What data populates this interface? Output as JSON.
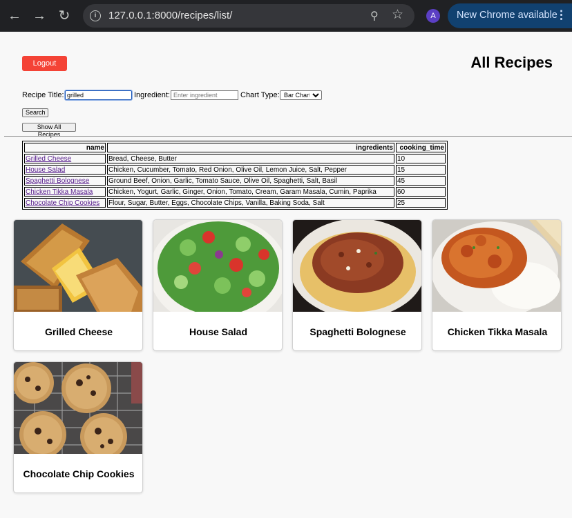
{
  "browser": {
    "url": "127.0.0.1:8000/recipes/list/",
    "avatar_letter": "A",
    "update_label": "New Chrome available"
  },
  "header": {
    "logout_label": "Logout",
    "title": "All Recipes"
  },
  "search": {
    "title_label": "Recipe Title:",
    "title_value": "grilled",
    "ingredient_label": "Ingredient:",
    "ingredient_placeholder": "Enter ingredient",
    "chart_label": "Chart Type:",
    "chart_value": "Bar Chart",
    "search_label": "Search",
    "show_all_label": "Show All Recipes"
  },
  "table": {
    "headers": [
      "name",
      "ingredients",
      "cooking_time"
    ],
    "rows": [
      {
        "name": "Grilled Cheese",
        "ingredients": "Bread, Cheese, Butter",
        "cooking_time": "10"
      },
      {
        "name": "House Salad",
        "ingredients": "Chicken, Cucumber, Tomato, Red Onion, Olive Oil, Lemon Juice, Salt, Pepper",
        "cooking_time": "15"
      },
      {
        "name": "Spaghetti Bolognese",
        "ingredients": "Ground Beef, Onion, Garlic, Tomato Sauce, Olive Oil, Spaghetti, Salt, Basil",
        "cooking_time": "45"
      },
      {
        "name": "Chicken Tikka Masala",
        "ingredients": "Chicken, Yogurt, Garlic, Ginger, Onion, Tomato, Cream, Garam Masala, Cumin, Paprika",
        "cooking_time": "60"
      },
      {
        "name": "Chocolate Chip Cookies",
        "ingredients": "Flour, Sugar, Butter, Eggs, Chocolate Chips, Vanilla, Baking Soda, Salt",
        "cooking_time": "25"
      }
    ]
  },
  "cards": [
    {
      "title": "Grilled Cheese",
      "image": "grilled-cheese-photo"
    },
    {
      "title": "House Salad",
      "image": "house-salad-photo"
    },
    {
      "title": "Spaghetti Bolognese",
      "image": "spaghetti-bolognese-photo"
    },
    {
      "title": "Chicken Tikka Masala",
      "image": "chicken-tikka-masala-photo"
    },
    {
      "title": "Chocolate Chip Cookies",
      "image": "chocolate-chip-cookies-photo"
    }
  ],
  "colors": {
    "logout": "#f44336",
    "link_visited": "#551a8b",
    "update_pill": "#114170"
  }
}
